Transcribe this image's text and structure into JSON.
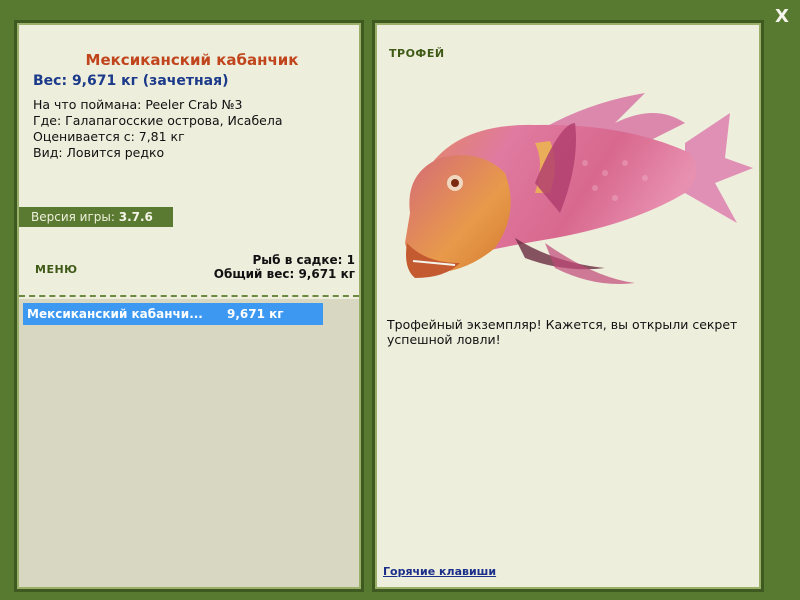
{
  "close_label": "X",
  "fish": {
    "name": "Мексиканский кабанчик",
    "weight_line": "Вес: 9,671 кг (зачетная)",
    "caught_on": "На что поймана: Peeler Crab №3",
    "location": "Где: Галапагосские острова, Исабела",
    "valued_from": "Оценивается с: 7,81 кг",
    "rarity": "Вид: Ловится редко"
  },
  "version": {
    "label": "Версия игры: ",
    "value": "3.7.6"
  },
  "menu_label": "МЕНЮ",
  "cage": {
    "count": "Рыб в садке: 1",
    "total": "Общий вес: 9,671 кг",
    "rows": [
      {
        "name": "Мексиканский кабанчи...",
        "weight": "9,671 кг"
      }
    ]
  },
  "trophy": {
    "label": "ТРОФЕЙ",
    "description": "Трофейный экземпляр! Кажется, вы открыли секрет успешной ловли!",
    "hotkeys_link": "Горячие клавиши"
  },
  "colors": {
    "frame": "#587a30",
    "panel": "#eeeedd",
    "title": "#c0451c",
    "weight": "#1b3a8a",
    "selected_row": "#3c98f0"
  }
}
